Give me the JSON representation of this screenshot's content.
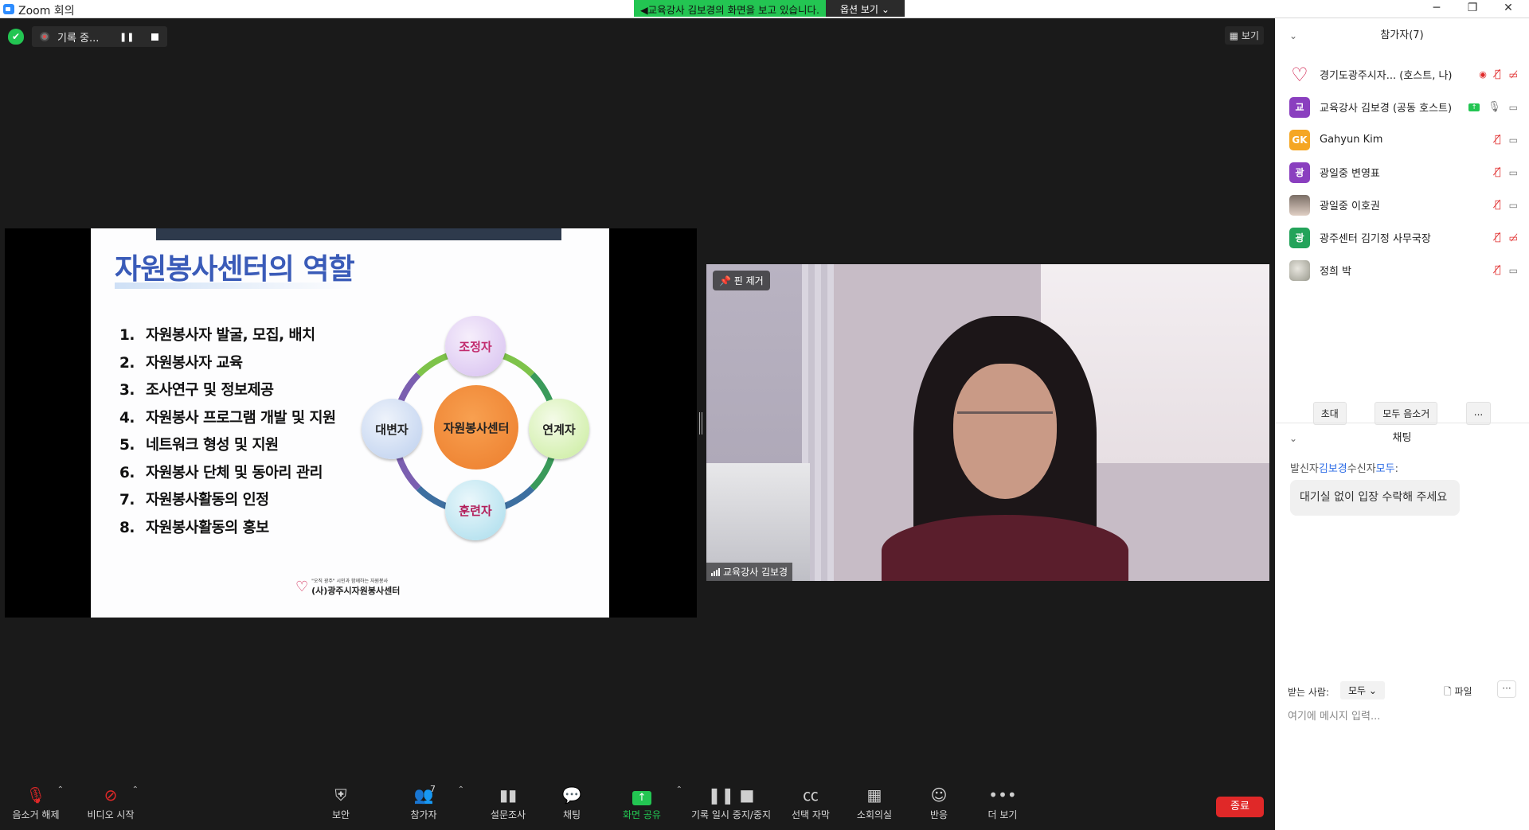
{
  "window": {
    "title": "Zoom 회의"
  },
  "share_banner": {
    "message": "교육강사 김보경의 화면을 보고 있습니다.",
    "options_label": "옵션 보기"
  },
  "status": {
    "recording_label": "기록 중...",
    "view_label": "보기"
  },
  "slide": {
    "heading": "자원봉사센터의 역할",
    "roles": [
      {
        "num": "1.",
        "text": "자원봉사자 발굴, 모집, 배치"
      },
      {
        "num": "2.",
        "text": "자원봉사자 교육"
      },
      {
        "num": "3.",
        "text": "조사연구 및 정보제공"
      },
      {
        "num": "4.",
        "text": "자원봉사 프로그램 개발 및 지원"
      },
      {
        "num": "5.",
        "text": "네트워크 형성 및 지원"
      },
      {
        "num": "6.",
        "text": "자원봉사 단체 및 동아리 관리"
      },
      {
        "num": "7.",
        "text": "자원봉사활동의 인정"
      },
      {
        "num": "8.",
        "text": "자원봉사활동의 홍보"
      }
    ],
    "cycle": {
      "center": "자원봉사센터",
      "top": "조정자",
      "right": "연계자",
      "bottom": "훈련자",
      "left": "대변자"
    },
    "logo": {
      "tagline": "\"오직 광주\" 시민과 함께하는 자원봉사",
      "name": "(사)광주시자원봉사센터"
    }
  },
  "video": {
    "pin_label": "핀 제거",
    "name": "교육강사 김보경"
  },
  "toolbar": {
    "mute": "음소거 해제",
    "video": "비디오 시작",
    "security": "보안",
    "participants": "참가자",
    "participants_count": "7",
    "polls": "설문조사",
    "chat": "채팅",
    "share": "화면 공유",
    "pause_record": "기록 일시 중지/중지",
    "captions": "선택 자막",
    "breakout": "소회의실",
    "reactions": "반응",
    "more": "더 보기",
    "end": "종료"
  },
  "panel": {
    "participants_title": "참가자(7)",
    "participants": [
      {
        "avatar": "heart",
        "initials": "♡",
        "color": "#ffffff",
        "name": "경기도광주시자...  (호스트, 나)",
        "icons": "host"
      },
      {
        "avatar": "initials",
        "initials": "교",
        "color": "#8a3fbf",
        "name": "교육강사 김보경 (공동 호스트)",
        "icons": "cohost"
      },
      {
        "avatar": "initials",
        "initials": "GK",
        "color": "#f5a623",
        "name": "Gahyun Kim",
        "icons": "muted"
      },
      {
        "avatar": "initials",
        "initials": "광",
        "color": "#8a3fbf",
        "name": "광일중 변영표",
        "icons": "muted"
      },
      {
        "avatar": "photo",
        "initials": "",
        "color": "#7a6e66",
        "name": "광일중 이호권",
        "icons": "muted"
      },
      {
        "avatar": "initials",
        "initials": "광",
        "color": "#23a35a",
        "name": "광주센터 김기정 사무국장",
        "icons": "muted-camoff"
      },
      {
        "avatar": "pattern",
        "initials": "",
        "color": "#9a9a8e",
        "name": "정희 박",
        "icons": "muted"
      }
    ],
    "invite": "초대",
    "mute_all": "모두 음소거",
    "more": "...",
    "chat_title": "채팅",
    "chat_from_label": "발신자",
    "chat_from_name": "김보경",
    "chat_to_label": "수신자",
    "chat_to_name": "모두",
    "chat_message": "대기실 없이 입장 수락해 주세요",
    "recipient_label": "받는 사람:",
    "recipient_value": "모두",
    "file_label": "파일",
    "input_placeholder": "여기에 메시지 입력..."
  }
}
